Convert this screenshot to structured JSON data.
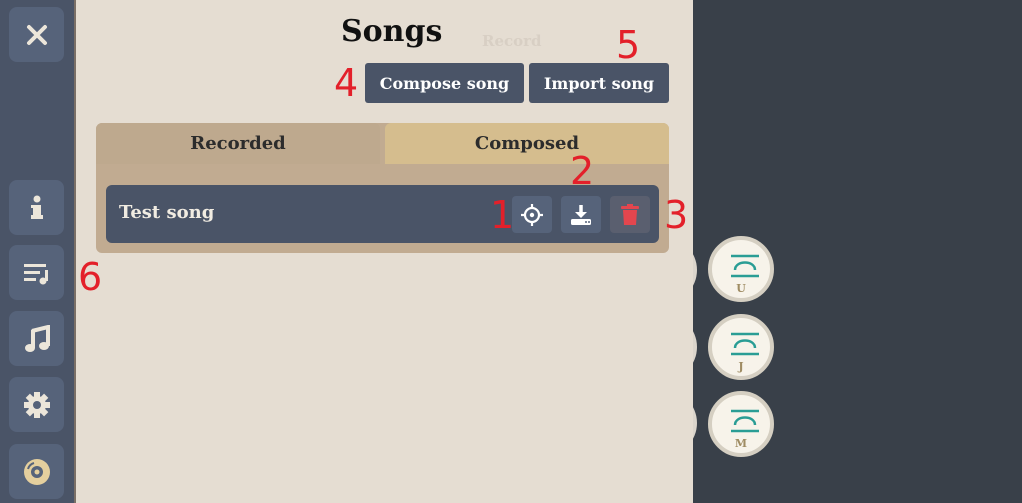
{
  "sidebar": {
    "items": [
      {
        "icon": "close-icon"
      },
      {
        "icon": "info-icon"
      },
      {
        "icon": "song-list-icon"
      },
      {
        "icon": "music-note-icon"
      },
      {
        "icon": "gear-icon"
      },
      {
        "icon": "disc-icon"
      }
    ]
  },
  "panel": {
    "title": "Songs",
    "record_label": "Record",
    "compose_label": "Compose song",
    "import_label": "Import song",
    "tabs": [
      {
        "label": "Recorded",
        "active": true
      },
      {
        "label": "Composed",
        "active": false
      }
    ],
    "songs": [
      {
        "name": "Test song"
      }
    ]
  },
  "keyboard": {
    "visible_keys": [
      "U",
      "J",
      "M"
    ]
  },
  "annotations": {
    "n1": "1",
    "n2": "2",
    "n3": "3",
    "n4": "4",
    "n5": "5",
    "n6": "6"
  },
  "colors": {
    "sidebar": "#4a5467",
    "panel": "#e5ddd2",
    "accent_teal": "#2a9d95",
    "delete_red": "#e3464e",
    "annotation_red": "#e3202a"
  }
}
